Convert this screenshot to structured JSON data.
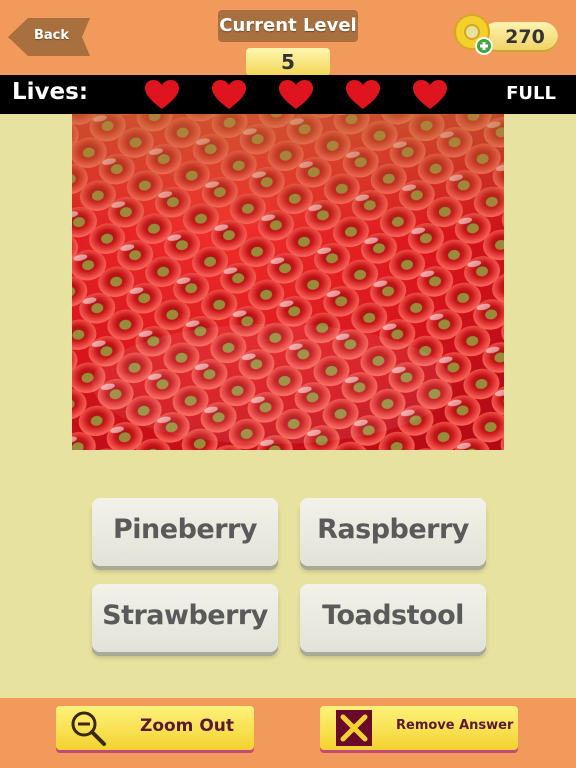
{
  "header": {
    "back_label": "Back",
    "level_title": "Current Level",
    "level_value": "5",
    "coins": "270"
  },
  "lives": {
    "label": "Lives:",
    "status": "FULL",
    "count": 5,
    "max": 5,
    "heart_color": "#e0141e"
  },
  "answers": [
    {
      "label": "Pineberry"
    },
    {
      "label": "Raspberry"
    },
    {
      "label": "Strawberry"
    },
    {
      "label": "Toadstool"
    }
  ],
  "tools": {
    "zoom_out_label": "Zoom Out",
    "remove_answer_label": "Remove Answer"
  },
  "colors": {
    "background": "#e8e2a0",
    "bar": "#f29a5b",
    "button_yellow": "#f2d230"
  }
}
